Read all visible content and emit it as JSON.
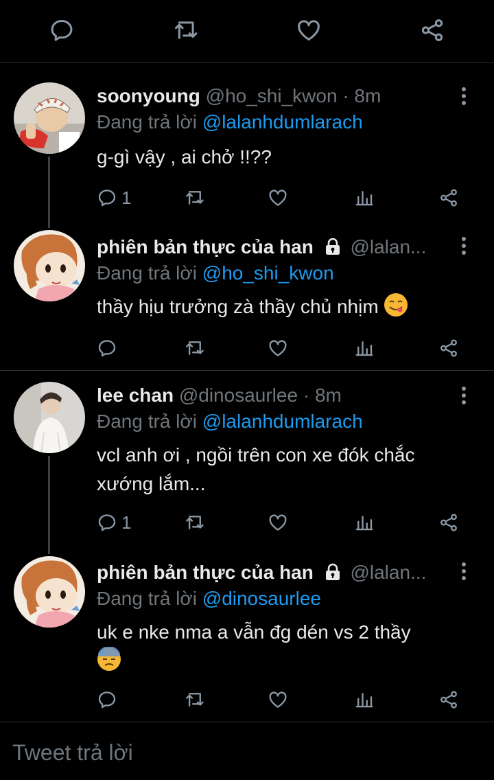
{
  "top_actions": {
    "icons": [
      "reply-icon",
      "retweet-icon",
      "like-icon",
      "share-icon"
    ]
  },
  "tweets": [
    {
      "name": "soonyoung",
      "handle": "@ho_shi_kwon",
      "separator": "·",
      "time": "8m",
      "reply_prefix": "Đang trả lời",
      "reply_mention": "@lalanhdumlarach",
      "text": "g-gì vậy , ai chở !!??",
      "reply_count": "1",
      "protected": false
    },
    {
      "name": "phiên bản thực của han",
      "handle": "@lalan...",
      "reply_prefix": "Đang trả lời",
      "reply_mention": "@ho_shi_kwon",
      "text": "thầy hịu trưởng zà thầy chủ nhịm",
      "emoji": "yum-face-emoji",
      "reply_count": "",
      "protected": true
    },
    {
      "name": "lee chan",
      "handle": "@dinosaurlee",
      "separator": "·",
      "time": "8m",
      "reply_prefix": "Đang trả lời",
      "reply_mention": "@lalanhdumlarach",
      "text_line1": "vcl anh ơi , ngồi trên con xe đók chắc",
      "text_line2": "xướng lắm...",
      "reply_count": "1",
      "protected": false
    },
    {
      "name": "phiên bản thực của han",
      "handle": "@lalan...",
      "reply_prefix": "Đang trả lời",
      "reply_mention": "@dinosaurlee",
      "text": "uk e nke nma a vẫn đg dén vs 2 thầy",
      "emoji": "sweat-face-emoji",
      "reply_count": "",
      "protected": true
    }
  ],
  "composer": {
    "placeholder": "Tweet trả lời"
  },
  "colors": {
    "background": "#000000",
    "text": "#e7e9ea",
    "muted": "#71767b",
    "mention": "#1d9bf0",
    "divider": "#2f3336",
    "icon": "#8b98a5"
  }
}
